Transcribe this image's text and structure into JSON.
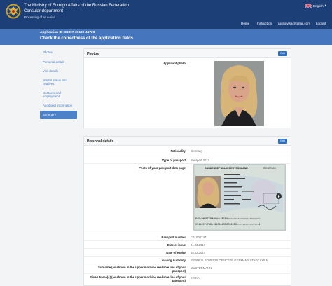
{
  "header": {
    "brand_line1": "The Ministry of Foreign Affairs of the Russian Federation",
    "brand_line2": "Consular department",
    "brand_sub": "Processing of an e-visa",
    "language": "English",
    "nav": {
      "home": "Home",
      "instruction": "Instruction",
      "email": "russiavisa@gmail.com",
      "logout": "Logout"
    }
  },
  "subheader": {
    "application_id": "Application ID: 81907-36100-41720",
    "heading": "Check the correctness of the application fields"
  },
  "sidebar": {
    "items": [
      {
        "label": "Photos"
      },
      {
        "label": "Personal details"
      },
      {
        "label": "Visit details"
      },
      {
        "label": "Marital status and relatives"
      },
      {
        "label": "Contacts and employment"
      },
      {
        "label": "Additional information"
      },
      {
        "label": "Summary"
      }
    ]
  },
  "photos_panel": {
    "title": "Photos",
    "edit_label": "Edit",
    "applicant_photo_label": "Applicant photo"
  },
  "personal_panel": {
    "title": "Personal details",
    "edit_label": "Edit",
    "rows": [
      {
        "label": "Nationality",
        "value": "Germany"
      },
      {
        "label": "Type of passport",
        "value": "Passport 2017"
      },
      {
        "label": "Photo of your passport data page",
        "value": ""
      },
      {
        "label": "Passport number",
        "value": "C01X00T47"
      },
      {
        "label": "Date of issue",
        "value": "01.03.2017"
      },
      {
        "label": "Date of expiry",
        "value": "28.02.2027"
      },
      {
        "label": "Issuing Authority",
        "value": "FEDERAL FOREIGN OFFICE IN GERMANY STADT KÖLN"
      },
      {
        "label": "Surname (as shown in the upper machine readable line of your passport)",
        "value": "MUSTERMANN"
      },
      {
        "label": "Given Name(s) (as shown in the upper machine readable line of your passport)",
        "value": "ERIKA"
      }
    ]
  },
  "passport_image": {
    "country_text": "BUNDESREPUBLIK DEUTSCHLAND",
    "doc_text": "REISEPASS",
    "mrz1": "P<D<<MUSTERMANN<<ERIKA<<<<<<<<<<<<<<<<<<<<<<",
    "mrz2": "C01X00T478D<<6408125F2702283<<<<<<<<<<<<<<<4"
  },
  "colors": {
    "header_bg": "#1c3f78",
    "subheader_bg": "#4576bd",
    "accent": "#2c6fc1",
    "link": "#4a7bc0"
  }
}
